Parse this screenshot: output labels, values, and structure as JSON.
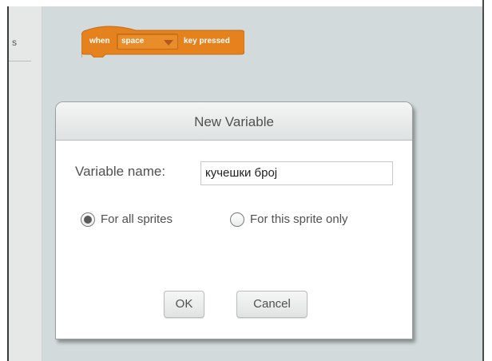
{
  "script_area": {
    "hat_block": {
      "prefix": "when",
      "key_value": "space",
      "suffix": "key pressed",
      "color": "#e6821e"
    },
    "background_color": "#d2dadb"
  },
  "palette": {
    "cut_char": "s"
  },
  "dialog": {
    "title": "New Variable",
    "name_label": "Variable name:",
    "name_value": "кучешки број",
    "scope_options": [
      {
        "label": "For all sprites",
        "selected": true
      },
      {
        "label": "For this sprite only",
        "selected": false
      }
    ],
    "ok_label": "OK",
    "cancel_label": "Cancel"
  }
}
